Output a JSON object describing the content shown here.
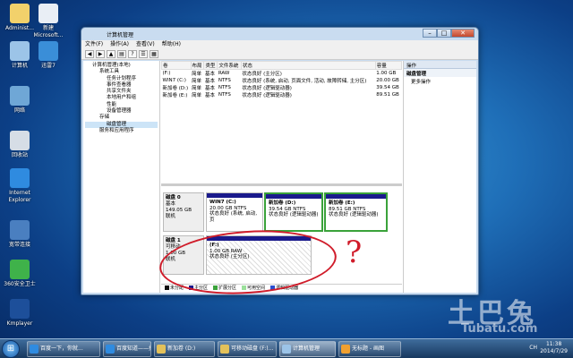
{
  "desktop": {
    "icons": [
      {
        "label": "Administ...",
        "color": "#f2d16b"
      },
      {
        "label": "新建 Microsoft...",
        "color": "#e9eef5"
      },
      {
        "label": "计算机",
        "color": "#9cc4e8"
      },
      {
        "label": "迅雷7",
        "color": "#3a8ed8"
      },
      {
        "label": "网络",
        "color": "#6fa7d6"
      },
      {
        "label": "回收站",
        "color": "#d6dde6"
      },
      {
        "label": "Internet Explorer",
        "color": "#2f8be0"
      },
      {
        "label": "宽带连接",
        "color": "#4a7fc0"
      },
      {
        "label": "360安全卫士",
        "color": "#3fb24a"
      },
      {
        "label": "Kmplayer",
        "color": "#1d4f9a"
      }
    ]
  },
  "window": {
    "title": "计算机管理",
    "menu": [
      "文件(F)",
      "操作(A)",
      "查看(V)",
      "帮助(H)"
    ],
    "toolbar_icons": [
      "back-icon",
      "forward-icon",
      "up-icon",
      "properties-icon",
      "help-icon",
      "list-icon",
      "grid-icon"
    ]
  },
  "tree": {
    "items": [
      {
        "label": "计算机管理(本地)",
        "level": 1
      },
      {
        "label": "系统工具",
        "level": 2
      },
      {
        "label": "任务计划程序",
        "level": 3
      },
      {
        "label": "事件查看器",
        "level": 3
      },
      {
        "label": "共享文件夹",
        "level": 3
      },
      {
        "label": "本地用户和组",
        "level": 3
      },
      {
        "label": "性能",
        "level": 3
      },
      {
        "label": "设备管理器",
        "level": 3
      },
      {
        "label": "存储",
        "level": 2
      },
      {
        "label": "磁盘管理",
        "level": 3,
        "selected": true
      },
      {
        "label": "服务和应用程序",
        "level": 2
      }
    ]
  },
  "volumes": {
    "headers": [
      "卷",
      "布局",
      "类型",
      "文件系统",
      "状态",
      "容量"
    ],
    "rows": [
      [
        "(F:)",
        "简单",
        "基本",
        "RAW",
        "状态良好 (主分区)",
        "1.00 GB"
      ],
      [
        "WIN7 (C:)",
        "简单",
        "基本",
        "NTFS",
        "状态良好 (系统, 启动, 页面文件, 活动, 故障转储, 主分区)",
        "20.00 GB"
      ],
      [
        "新加卷 (D:)",
        "简单",
        "基本",
        "NTFS",
        "状态良好 (逻辑驱动器)",
        "39.54 GB"
      ],
      [
        "新加卷 (E:)",
        "简单",
        "基本",
        "NTFS",
        "状态良好 (逻辑驱动器)",
        "89.51 GB"
      ]
    ]
  },
  "disk0": {
    "name": "磁盘 0",
    "type": "基本",
    "size": "149.05 GB",
    "status": "联机",
    "partitions": [
      {
        "name": "WIN7 (C:)",
        "size": "20.00 GB NTFS",
        "status": "状态良好 (系统, 启动, 页"
      },
      {
        "name": "新加卷 (D:)",
        "size": "39.54 GB NTFS",
        "status": "状态良好 (逻辑驱动器)"
      },
      {
        "name": "新加卷 (E:)",
        "size": "89.51 GB NTFS",
        "status": "状态良好 (逻辑驱动器)"
      }
    ]
  },
  "disk1": {
    "name": "磁盘 1",
    "type": "可移动",
    "size": "1.00 GB",
    "status": "联机",
    "partition": {
      "name": "(F:)",
      "size": "1.00 GB RAW",
      "status": "状态良好 (主分区)"
    }
  },
  "legend": [
    {
      "label": "未分配",
      "color": "#111111"
    },
    {
      "label": "主分区",
      "color": "#1a1a8c"
    },
    {
      "label": "扩展分区",
      "color": "#3aa23a"
    },
    {
      "label": "可用空间",
      "color": "#9be09b"
    },
    {
      "label": "逻辑驱动器",
      "color": "#2a4fd0"
    }
  ],
  "actions": {
    "header": "操作",
    "section": "磁盘管理",
    "more": "更多操作"
  },
  "annotation": {
    "mark": "?"
  },
  "watermark": {
    "line1": "土巴兔",
    "line2": "Tubatu.com"
  },
  "taskbar": {
    "buttons": [
      {
        "label": "百度一下，你就...",
        "color": "#2f8be0",
        "active": false
      },
      {
        "label": "百度知道——搜...",
        "color": "#2f8be0",
        "active": false
      },
      {
        "label": "新加卷 (D:)",
        "color": "#e3c15a",
        "active": false
      },
      {
        "label": "可移动磁盘 (F:)...",
        "color": "#e3c15a",
        "active": false
      },
      {
        "label": "计算机管理",
        "color": "#9cc4e8",
        "active": true
      },
      {
        "label": "无标题 - 画图",
        "color": "#f0a030",
        "active": false
      }
    ],
    "time": "11:38",
    "date": "2014/7/29",
    "lang": "CH"
  }
}
